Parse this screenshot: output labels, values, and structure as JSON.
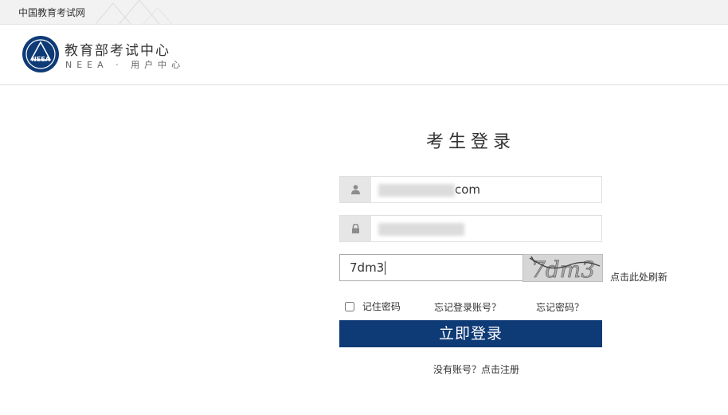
{
  "topbar": {
    "site_link": "中国教育考试网"
  },
  "header": {
    "emblem_text": "NEEA",
    "org_name": "教育部考试中心",
    "org_sub": "NEEA · 用户中心"
  },
  "login": {
    "title": "考生登录",
    "username": {
      "suffix": "com",
      "icon": "user-icon"
    },
    "password": {
      "icon": "lock-icon"
    },
    "captcha": {
      "value": "7dm3",
      "image_text": "7dm3",
      "refresh_label": "点击此处刷新"
    },
    "remember_label": "记住密码",
    "forgot_account": "忘记登录账号？",
    "forgot_password": "忘记密码？",
    "submit_label": "立即登录",
    "register_link": "没有账号？点击注册"
  },
  "colors": {
    "primary": "#0e3a76",
    "topbar_bg": "#f2f2f2",
    "icon_box": "#e6e6e6"
  }
}
